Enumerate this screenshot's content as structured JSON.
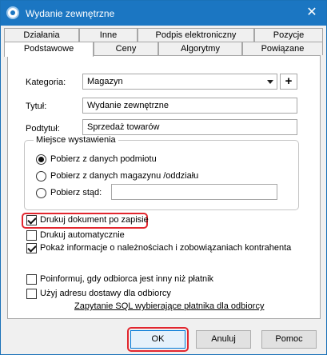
{
  "window": {
    "title": "Wydanie zewnętrzne",
    "close_glyph": "✕",
    "icon": "app-icon"
  },
  "tabs_row1": [
    "Działania",
    "Inne",
    "Podpis elektroniczny",
    "Pozycje"
  ],
  "tabs_row2": [
    "Podstawowe",
    "Ceny",
    "Algorytmy",
    "Powiązane"
  ],
  "active_tab": "Podstawowe",
  "form": {
    "kategoria_label": "Kategoria:",
    "kategoria_value": "Magazyn",
    "plus_label": "+",
    "tytul_label": "Tytuł:",
    "tytul_value": "Wydanie zewnętrzne",
    "podtytul_label": "Podtytuł:",
    "podtytul_value": "Sprzedaż towarów"
  },
  "miejsce": {
    "title": "Miejsce wystawienia",
    "options": [
      {
        "label": "Pobierz z danych podmiotu",
        "checked": true
      },
      {
        "label": "Pobierz z danych magazynu /oddziału",
        "checked": false
      },
      {
        "label": "Pobierz stąd:",
        "checked": false
      }
    ],
    "pobierz_stad_value": ""
  },
  "checkboxes": [
    {
      "label": "Drukuj dokument po zapisie",
      "checked": true,
      "highlighted": true
    },
    {
      "label": "Drukuj automatycznie",
      "checked": false
    },
    {
      "label": "Pokaż informacje o należnościach i zobowiązaniach kontrahenta",
      "checked": true
    },
    {
      "label": "Poinformuj, gdy odbiorca jest inny niż płatnik",
      "checked": false
    },
    {
      "label": "Użyj adresu dostawy dla odbiorcy",
      "checked": false
    }
  ],
  "sql_link": "Zapytanie SQL wybierające płatnika dla odbiorcy",
  "buttons": {
    "ok": "OK",
    "cancel": "Anuluj",
    "help": "Pomoc"
  },
  "colors": {
    "title_bar": "#1b76c2",
    "highlight": "#e2262e"
  }
}
